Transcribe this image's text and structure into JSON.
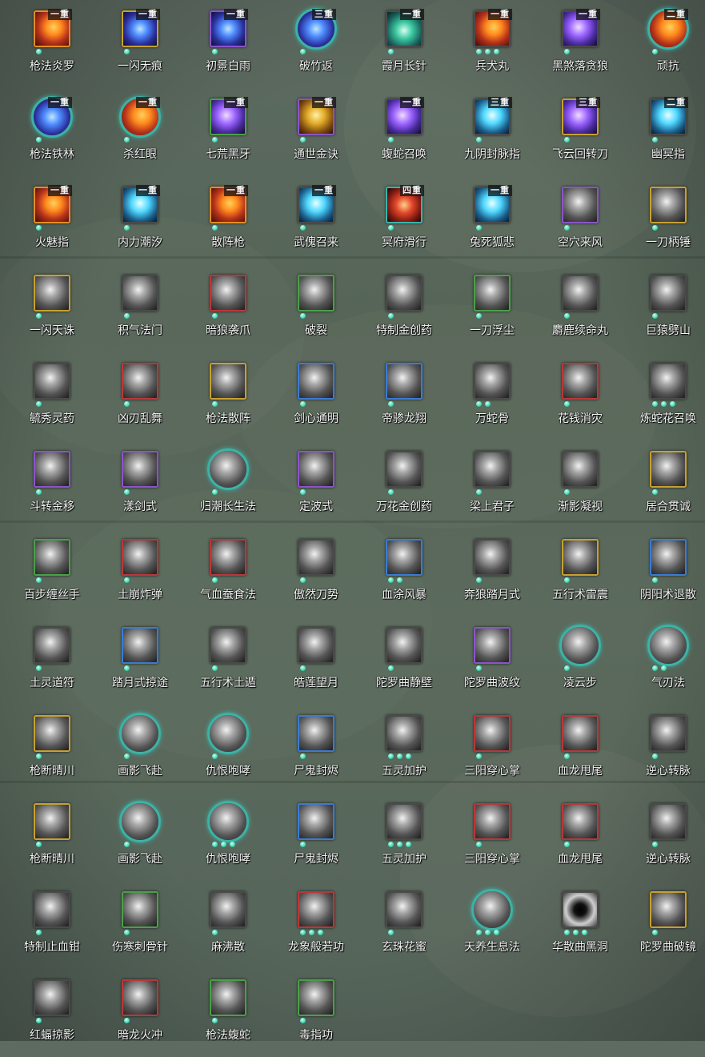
{
  "rarity_colors": {
    "orange": "#e38d25",
    "purple": "#8b54c9",
    "blue": "#3a7bd5",
    "green": "#4aa048",
    "red": "#b9373a",
    "gray": "#4a4a4a",
    "gold": "#c8a030",
    "teal": "#3bb3a6"
  },
  "skills": [
    {
      "name": "枪法炎罗",
      "rank": "一重",
      "frame": "orange",
      "art": "fire",
      "shape": "square",
      "dots": 1
    },
    {
      "name": "一闪无痕",
      "rank": "一重",
      "frame": "gold",
      "art": "blue",
      "shape": "square",
      "dots": 1
    },
    {
      "name": "初景白雨",
      "rank": "一重",
      "frame": "purple",
      "art": "blue",
      "shape": "square",
      "dots": 1
    },
    {
      "name": "破竹返",
      "rank": "三重",
      "frame": "teal",
      "art": "blue",
      "shape": "round",
      "dots": 1
    },
    {
      "name": "霞月长针",
      "rank": "一重",
      "frame": "gray",
      "art": "teal",
      "shape": "square",
      "dots": 1
    },
    {
      "name": "兵犬丸",
      "rank": "一重",
      "frame": "gray",
      "art": "fire",
      "shape": "square",
      "dots": 3
    },
    {
      "name": "黑煞落贪狼",
      "rank": "一重",
      "frame": "gray",
      "art": "violet",
      "shape": "square",
      "dots": 1
    },
    {
      "name": "顽抗",
      "rank": "二重",
      "frame": "teal",
      "art": "fire",
      "shape": "round",
      "dots": 1
    },
    {
      "name": "枪法铁林",
      "rank": "一重",
      "frame": "teal",
      "art": "blue",
      "shape": "round",
      "dots": 1
    },
    {
      "name": "杀红眼",
      "rank": "一重",
      "frame": "teal",
      "art": "fire",
      "shape": "round",
      "dots": 1
    },
    {
      "name": "七荒黑牙",
      "rank": "一重",
      "frame": "green",
      "art": "violet",
      "shape": "square",
      "dots": 1
    },
    {
      "name": "通世金诀",
      "rank": "一重",
      "frame": "purple",
      "art": "gold",
      "shape": "square",
      "dots": 1
    },
    {
      "name": "蝮蛇召唤",
      "rank": "一重",
      "frame": "gray",
      "art": "violet",
      "shape": "square",
      "dots": 1
    },
    {
      "name": "九阴封脉指",
      "rank": "三重",
      "frame": "gray",
      "art": "cyan",
      "shape": "square",
      "dots": 1
    },
    {
      "name": "飞云回转刀",
      "rank": "三重",
      "frame": "gold",
      "art": "violet",
      "shape": "square",
      "dots": 1
    },
    {
      "name": "幽冥指",
      "rank": "二重",
      "frame": "gray",
      "art": "cyan",
      "shape": "square",
      "dots": 1
    },
    {
      "name": "火魅指",
      "rank": "一重",
      "frame": "orange",
      "art": "fire",
      "shape": "square",
      "dots": 1
    },
    {
      "name": "内力潮汐",
      "rank": "一重",
      "frame": "gray",
      "art": "cyan",
      "shape": "square",
      "dots": 1
    },
    {
      "name": "散阵枪",
      "rank": "一重",
      "frame": "orange",
      "art": "fire",
      "shape": "square",
      "dots": 1
    },
    {
      "name": "武傀召来",
      "rank": "一重",
      "frame": "gray",
      "art": "cyan",
      "shape": "square",
      "dots": 1
    },
    {
      "name": "冥府滑行",
      "rank": "四重",
      "frame": "teal",
      "art": "red",
      "shape": "square",
      "dots": 1
    },
    {
      "name": "兔死狐悲",
      "rank": "一重",
      "frame": "gray",
      "art": "cyan",
      "shape": "square",
      "dots": 1
    },
    {
      "name": "空穴来风",
      "rank": "",
      "frame": "purple",
      "art": "gray",
      "shape": "square",
      "dots": 1
    },
    {
      "name": "一刀柄锤",
      "rank": "",
      "frame": "gold",
      "art": "gray",
      "shape": "square",
      "dots": 1
    },
    {
      "name": "一闪天诛",
      "rank": "",
      "frame": "gold",
      "art": "gray",
      "shape": "square",
      "dots": 1
    },
    {
      "name": "积气法门",
      "rank": "",
      "frame": "gray",
      "art": "gray",
      "shape": "square",
      "dots": 1
    },
    {
      "name": "暗狼袭爪",
      "rank": "",
      "frame": "red",
      "art": "gray",
      "shape": "square",
      "dots": 1
    },
    {
      "name": "破裂",
      "rank": "",
      "frame": "green",
      "art": "gray",
      "shape": "square",
      "dots": 1
    },
    {
      "name": "特制金创药",
      "rank": "",
      "frame": "gray",
      "art": "gray",
      "shape": "square",
      "dots": 1
    },
    {
      "name": "一刀浮尘",
      "rank": "",
      "frame": "green",
      "art": "gray",
      "shape": "square",
      "dots": 1
    },
    {
      "name": "麝鹿续命丸",
      "rank": "",
      "frame": "gray",
      "art": "gray",
      "shape": "square",
      "dots": 1
    },
    {
      "name": "巨猿劈山",
      "rank": "",
      "frame": "gray",
      "art": "gray",
      "shape": "square",
      "dots": 1
    },
    {
      "name": "毓秀灵药",
      "rank": "",
      "frame": "gray",
      "art": "gray",
      "shape": "square",
      "dots": 1
    },
    {
      "name": "凶刃乱舞",
      "rank": "",
      "frame": "red",
      "art": "gray",
      "shape": "square",
      "dots": 1
    },
    {
      "name": "枪法散阵",
      "rank": "",
      "frame": "gold",
      "art": "gray",
      "shape": "square",
      "dots": 1
    },
    {
      "name": "剑心通明",
      "rank": "",
      "frame": "blue",
      "art": "gray",
      "shape": "square",
      "dots": 1
    },
    {
      "name": "帝骖龙翔",
      "rank": "",
      "frame": "blue",
      "art": "gray",
      "shape": "square",
      "dots": 1
    },
    {
      "name": "万蛇骨",
      "rank": "",
      "frame": "gray",
      "art": "gray",
      "shape": "square",
      "dots": 2
    },
    {
      "name": "花钱消灾",
      "rank": "",
      "frame": "red",
      "art": "gray",
      "shape": "square",
      "dots": 1
    },
    {
      "name": "炼蛇花召唤",
      "rank": "",
      "frame": "gray",
      "art": "gray",
      "shape": "square",
      "dots": 3
    },
    {
      "name": "斗转金移",
      "rank": "",
      "frame": "purple",
      "art": "gray",
      "shape": "square",
      "dots": 1
    },
    {
      "name": "漾剑式",
      "rank": "",
      "frame": "purple",
      "art": "gray",
      "shape": "square",
      "dots": 1
    },
    {
      "name": "归潮长生法",
      "rank": "",
      "frame": "teal",
      "art": "gray",
      "shape": "round",
      "dots": 1
    },
    {
      "name": "定波式",
      "rank": "",
      "frame": "purple",
      "art": "gray",
      "shape": "square",
      "dots": 1
    },
    {
      "name": "万花金创药",
      "rank": "",
      "frame": "gray",
      "art": "gray",
      "shape": "square",
      "dots": 1
    },
    {
      "name": "梁上君子",
      "rank": "",
      "frame": "gray",
      "art": "gray",
      "shape": "square",
      "dots": 1
    },
    {
      "name": "渐影凝视",
      "rank": "",
      "frame": "gray",
      "art": "gray",
      "shape": "square",
      "dots": 1
    },
    {
      "name": "居合贯诚",
      "rank": "",
      "frame": "gold",
      "art": "gray",
      "shape": "square",
      "dots": 1
    },
    {
      "name": "百步缠丝手",
      "rank": "",
      "frame": "green",
      "art": "gray",
      "shape": "square",
      "dots": 1
    },
    {
      "name": "土崩炸弹",
      "rank": "",
      "frame": "red",
      "art": "gray",
      "shape": "square",
      "dots": 1
    },
    {
      "name": "气血蚕食法",
      "rank": "",
      "frame": "red",
      "art": "gray",
      "shape": "square",
      "dots": 1
    },
    {
      "name": "傲然刀势",
      "rank": "",
      "frame": "gray",
      "art": "gray",
      "shape": "square",
      "dots": 1
    },
    {
      "name": "血涂风暴",
      "rank": "",
      "frame": "blue",
      "art": "gray",
      "shape": "square",
      "dots": 2
    },
    {
      "name": "奔狼踏月式",
      "rank": "",
      "frame": "gray",
      "art": "gray",
      "shape": "square",
      "dots": 1
    },
    {
      "name": "五行术雷震",
      "rank": "",
      "frame": "gold",
      "art": "gray",
      "shape": "square",
      "dots": 1
    },
    {
      "name": "阴阳术退散",
      "rank": "",
      "frame": "blue",
      "art": "gray",
      "shape": "square",
      "dots": 1
    },
    {
      "name": "土灵道符",
      "rank": "",
      "frame": "gray",
      "art": "gray",
      "shape": "square",
      "dots": 1
    },
    {
      "name": "踏月式掠途",
      "rank": "",
      "frame": "blue",
      "art": "gray",
      "shape": "square",
      "dots": 1
    },
    {
      "name": "五行术土遁",
      "rank": "",
      "frame": "gray",
      "art": "gray",
      "shape": "square",
      "dots": 1
    },
    {
      "name": "皓莲望月",
      "rank": "",
      "frame": "gray",
      "art": "gray",
      "shape": "square",
      "dots": 1
    },
    {
      "name": "陀罗曲静壁",
      "rank": "",
      "frame": "gray",
      "art": "gray",
      "shape": "square",
      "dots": 1
    },
    {
      "name": "陀罗曲波纹",
      "rank": "",
      "frame": "purple",
      "art": "gray",
      "shape": "square",
      "dots": 1
    },
    {
      "name": "凌云步",
      "rank": "",
      "frame": "teal",
      "art": "gray",
      "shape": "round",
      "dots": 1
    },
    {
      "name": "气刃法",
      "rank": "",
      "frame": "teal",
      "art": "gray",
      "shape": "round",
      "dots": 2
    },
    {
      "name": "枪断晴川",
      "rank": "",
      "frame": "gold",
      "art": "gray",
      "shape": "square",
      "dots": 1
    },
    {
      "name": "画影飞赴",
      "rank": "",
      "frame": "teal",
      "art": "gray",
      "shape": "round",
      "dots": 1
    },
    {
      "name": "仇恨咆哮",
      "rank": "",
      "frame": "teal",
      "art": "gray",
      "shape": "round",
      "dots": 1
    },
    {
      "name": "尸鬼封烬",
      "rank": "",
      "frame": "blue",
      "art": "gray",
      "shape": "square",
      "dots": 1
    },
    {
      "name": "五灵加护",
      "rank": "",
      "frame": "gray",
      "art": "gray",
      "shape": "square",
      "dots": 3
    },
    {
      "name": "三阳穿心掌",
      "rank": "",
      "frame": "red",
      "art": "gray",
      "shape": "square",
      "dots": 1
    },
    {
      "name": "血龙甩尾",
      "rank": "",
      "frame": "red",
      "art": "gray",
      "shape": "square",
      "dots": 1
    },
    {
      "name": "逆心转脉",
      "rank": "",
      "frame": "gray",
      "art": "gray",
      "shape": "square",
      "dots": 1
    },
    {
      "name": "枪断晴川",
      "rank": "",
      "frame": "gold",
      "art": "gray",
      "shape": "square",
      "dots": 1
    },
    {
      "name": "画影飞赴",
      "rank": "",
      "frame": "teal",
      "art": "gray",
      "shape": "round",
      "dots": 1
    },
    {
      "name": "仇恨咆哮",
      "rank": "",
      "frame": "teal",
      "art": "gray",
      "shape": "round",
      "dots": 3
    },
    {
      "name": "尸鬼封烬",
      "rank": "",
      "frame": "blue",
      "art": "gray",
      "shape": "square",
      "dots": 1
    },
    {
      "name": "五灵加护",
      "rank": "",
      "frame": "gray",
      "art": "gray",
      "shape": "square",
      "dots": 3
    },
    {
      "name": "三阳穿心掌",
      "rank": "",
      "frame": "red",
      "art": "gray",
      "shape": "square",
      "dots": 1
    },
    {
      "name": "血龙甩尾",
      "rank": "",
      "frame": "red",
      "art": "gray",
      "shape": "square",
      "dots": 1
    },
    {
      "name": "逆心转脉",
      "rank": "",
      "frame": "gray",
      "art": "gray",
      "shape": "square",
      "dots": 1
    },
    {
      "name": "特制止血钳",
      "rank": "",
      "frame": "gray",
      "art": "gray",
      "shape": "square",
      "dots": 1
    },
    {
      "name": "伤寒刺骨针",
      "rank": "",
      "frame": "green",
      "art": "gray",
      "shape": "square",
      "dots": 1
    },
    {
      "name": "麻沸散",
      "rank": "",
      "frame": "gray",
      "art": "gray",
      "shape": "square",
      "dots": 1
    },
    {
      "name": "龙象般若功",
      "rank": "",
      "frame": "red",
      "art": "gray",
      "shape": "square",
      "dots": 3
    },
    {
      "name": "玄珠花蜜",
      "rank": "",
      "frame": "gray",
      "art": "gray",
      "shape": "square",
      "dots": 1
    },
    {
      "name": "天养生息法",
      "rank": "",
      "frame": "teal",
      "art": "gray",
      "shape": "round",
      "dots": 3
    },
    {
      "name": "华散曲黑洞",
      "rank": "",
      "frame": "gray",
      "art": "dark",
      "shape": "square",
      "dots": 3
    },
    {
      "name": "陀罗曲破镜",
      "rank": "",
      "frame": "gold",
      "art": "gray",
      "shape": "square",
      "dots": 1
    },
    {
      "name": "红蝠掠影",
      "rank": "",
      "frame": "gray",
      "art": "gray",
      "shape": "square",
      "dots": 1
    },
    {
      "name": "暗龙火冲",
      "rank": "",
      "frame": "red",
      "art": "gray",
      "shape": "square",
      "dots": 1
    },
    {
      "name": "枪法蝮蛇",
      "rank": "",
      "frame": "green",
      "art": "gray",
      "shape": "square",
      "dots": 1
    },
    {
      "name": "毒指功",
      "rank": "",
      "frame": "green",
      "art": "gray",
      "shape": "square",
      "dots": 1
    }
  ]
}
